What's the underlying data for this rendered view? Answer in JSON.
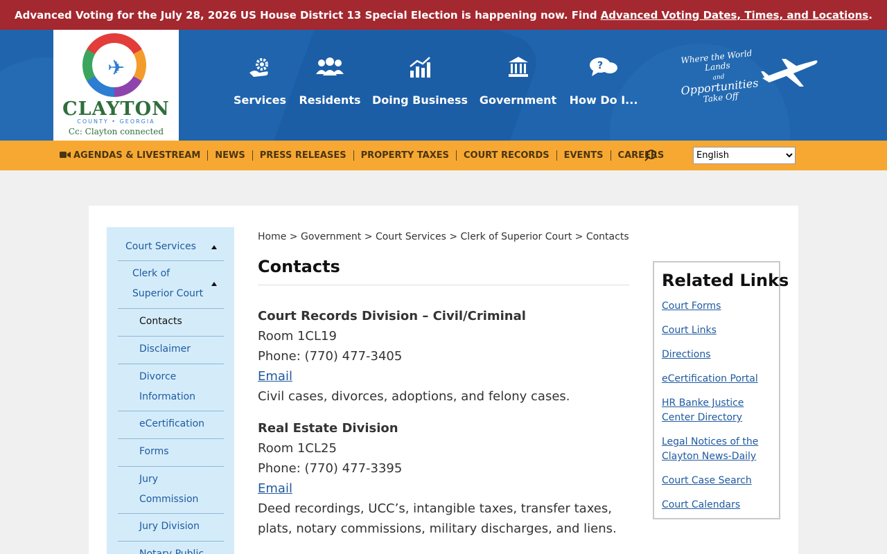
{
  "alert": {
    "text": "Advanced Voting for the July 28, 2026 US House District 13 Special Election is happening now. Find",
    "link": "Advanced Voting Dates, Times, and Locations",
    "end": "."
  },
  "logo": {
    "brand": "CLAYTON",
    "sub": "COUNTY • GEORGIA",
    "tagline": "Cc: Clayton connected"
  },
  "nav": {
    "services": "Services",
    "residents": "Residents",
    "doing_business": "Doing Business",
    "government": "Government",
    "how_do_i": "How Do I..."
  },
  "slogan": {
    "line1": "Where the World Lands",
    "line2a": "and",
    "line2b": "Opportunities",
    "line3": "Take Off"
  },
  "utility": {
    "agendas": "AGENDAS & LIVESTREAM",
    "news": "NEWS",
    "press": "PRESS RELEASES",
    "taxes": "PROPERTY TAXES",
    "court_records": "COURT RECORDS",
    "events": "EVENTS",
    "careers": "CAREERS",
    "language": "English"
  },
  "sidebar": {
    "court_services": "Court Services",
    "clerk_line1": "Clerk of",
    "clerk_line2": "Superior Court",
    "contacts": "Contacts",
    "disclaimer": "Disclaimer",
    "divorce_line1": "Divorce",
    "divorce_line2": "Information",
    "ecert": "eCertification",
    "forms": "Forms",
    "jury_comm_line1": "Jury",
    "jury_comm_line2": "Commission",
    "jury_div": "Jury Division",
    "notary": "Notary Public"
  },
  "breadcrumb": {
    "home": "Home",
    "government": "Government",
    "court_services": "Court Services",
    "clerk": "Clerk of Superior Court",
    "current": "Contacts",
    "sep": ">"
  },
  "page_title": "Contacts",
  "contacts": [
    {
      "heading": "Court Records Division – Civil/Criminal",
      "room": "Room 1CL19",
      "phone": "Phone: (770) 477-3405",
      "email": "Email",
      "desc": "Civil cases, divorces, adoptions, and felony cases."
    },
    {
      "heading": "Real Estate Division",
      "room": "Room 1CL25",
      "phone": "Phone: (770) 477-3395",
      "email": "Email",
      "desc": "Deed recordings, UCC’s, intangible taxes, transfer taxes, plats, notary commissions, military discharges, and liens."
    }
  ],
  "related": {
    "title": "Related Links",
    "links": [
      "Court Forms",
      "Court Links",
      "Directions",
      "eCertification Portal",
      "HR Banke Justice Center Directory",
      "Legal Notices of the Clayton News-Daily",
      "Court Case Search",
      "Court Calendars"
    ]
  }
}
